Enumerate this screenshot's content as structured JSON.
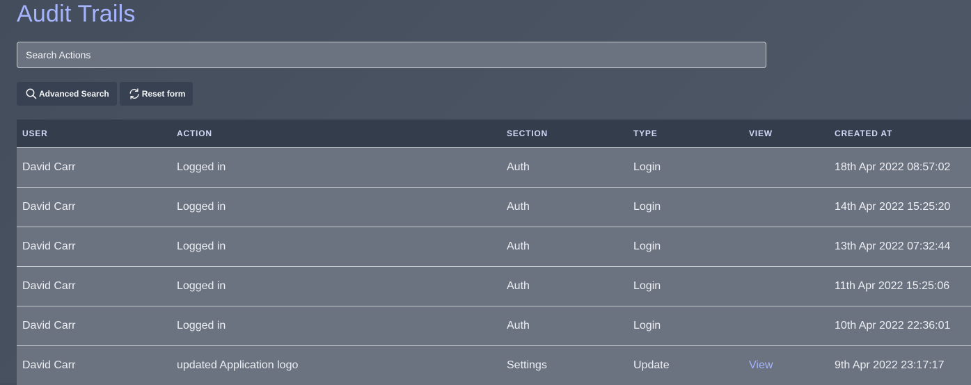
{
  "page": {
    "title": "Audit Trails"
  },
  "search": {
    "placeholder": "Search Actions",
    "value": ""
  },
  "buttons": {
    "advanced_search_label": "Advanced Search",
    "advanced_search_icon": "search-icon",
    "reset_form_label": "Reset form",
    "reset_form_icon": "refresh-icon"
  },
  "table": {
    "columns": [
      "USER",
      "ACTION",
      "SECTION",
      "TYPE",
      "VIEW",
      "CREATED AT"
    ],
    "rows": [
      {
        "user": "David Carr",
        "action": "Logged in",
        "section": "Auth",
        "type": "Login",
        "view": "",
        "created_at": "18th Apr 2022 08:57:02"
      },
      {
        "user": "David Carr",
        "action": "Logged in",
        "section": "Auth",
        "type": "Login",
        "view": "",
        "created_at": "14th Apr 2022 15:25:20"
      },
      {
        "user": "David Carr",
        "action": "Logged in",
        "section": "Auth",
        "type": "Login",
        "view": "",
        "created_at": "13th Apr 2022 07:32:44"
      },
      {
        "user": "David Carr",
        "action": "Logged in",
        "section": "Auth",
        "type": "Login",
        "view": "",
        "created_at": "11th Apr 2022 15:25:06"
      },
      {
        "user": "David Carr",
        "action": "Logged in",
        "section": "Auth",
        "type": "Login",
        "view": "",
        "created_at": "10th Apr 2022 22:36:01"
      },
      {
        "user": "David Carr",
        "action": "updated Application logo",
        "section": "Settings",
        "type": "Update",
        "view": "View",
        "created_at": "9th Apr 2022 23:17:17"
      }
    ]
  },
  "colors": {
    "accent": "#a5b4fc",
    "header_bg": "#333d4c",
    "row_bg": "#6b7280",
    "button_bg": "#374151"
  }
}
